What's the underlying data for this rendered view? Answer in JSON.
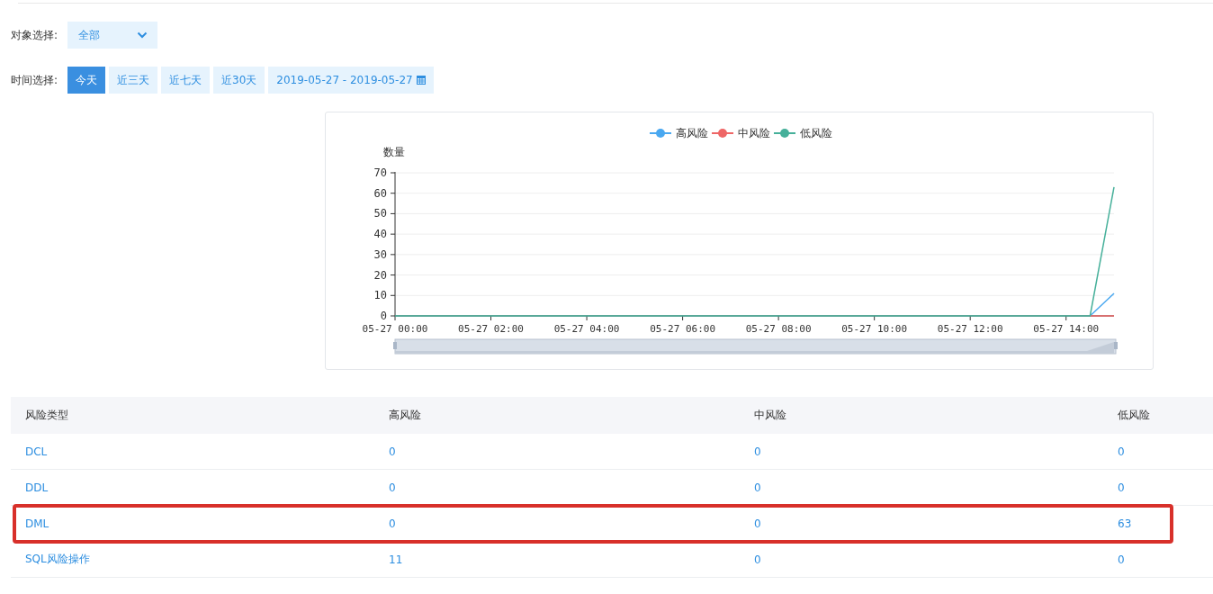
{
  "filters": {
    "object": {
      "label": "对象选择:",
      "value": "全部"
    },
    "time": {
      "label": "时间选择:",
      "options": [
        {
          "label": "今天",
          "selected": true
        },
        {
          "label": "近三天",
          "selected": false
        },
        {
          "label": "近七天",
          "selected": false
        },
        {
          "label": "近30天",
          "selected": false
        }
      ],
      "date_range": "2019-05-27 - 2019-05-27"
    }
  },
  "chart": {
    "chart_data": {
      "type": "line",
      "ylabel": "数量",
      "categories": [
        "05-27 00:00",
        null,
        null,
        null,
        "05-27 02:00",
        null,
        null,
        null,
        "05-27 04:00",
        null,
        null,
        null,
        "05-27 06:00",
        null,
        null,
        null,
        "05-27 08:00",
        null,
        null,
        null,
        "05-27 10:00",
        null,
        null,
        null,
        "05-27 12:00",
        null,
        null,
        null,
        "05-27 14:00",
        null,
        null
      ],
      "series": [
        {
          "name": "高风险",
          "color": "#4aa8f0",
          "values": [
            null,
            null,
            null,
            null,
            null,
            null,
            null,
            null,
            null,
            null,
            null,
            null,
            null,
            null,
            null,
            null,
            null,
            null,
            null,
            null,
            null,
            null,
            null,
            null,
            null,
            null,
            null,
            null,
            null,
            0,
            11
          ]
        },
        {
          "name": "中风险",
          "color": "#ee6666",
          "values": [
            null,
            null,
            null,
            null,
            null,
            null,
            null,
            null,
            null,
            null,
            null,
            null,
            null,
            null,
            null,
            null,
            null,
            null,
            null,
            null,
            null,
            null,
            null,
            null,
            null,
            null,
            null,
            null,
            null,
            0,
            0
          ]
        },
        {
          "name": "低风险",
          "color": "#46b09a",
          "values": [
            0,
            0,
            0,
            0,
            0,
            0,
            0,
            0,
            0,
            0,
            0,
            0,
            0,
            0,
            0,
            0,
            0,
            0,
            0,
            0,
            0,
            0,
            0,
            0,
            0,
            0,
            0,
            0,
            0,
            0,
            63
          ]
        }
      ],
      "ylim": [
        0,
        70
      ],
      "grid": true,
      "legend": true,
      "yticks": [
        0,
        10,
        20,
        30,
        40,
        50,
        60,
        70
      ]
    }
  },
  "table": {
    "columns": [
      "风险类型",
      "高风险",
      "中风险",
      "低风险"
    ],
    "rows": [
      {
        "cells": [
          "DCL",
          "0",
          "0",
          "0"
        ],
        "highlighted": false
      },
      {
        "cells": [
          "DDL",
          "0",
          "0",
          "0"
        ],
        "highlighted": false
      },
      {
        "cells": [
          "DML",
          "0",
          "0",
          "63"
        ],
        "highlighted": true
      },
      {
        "cells": [
          "SQL风险操作",
          "11",
          "0",
          "0"
        ],
        "highlighted": false
      }
    ]
  }
}
